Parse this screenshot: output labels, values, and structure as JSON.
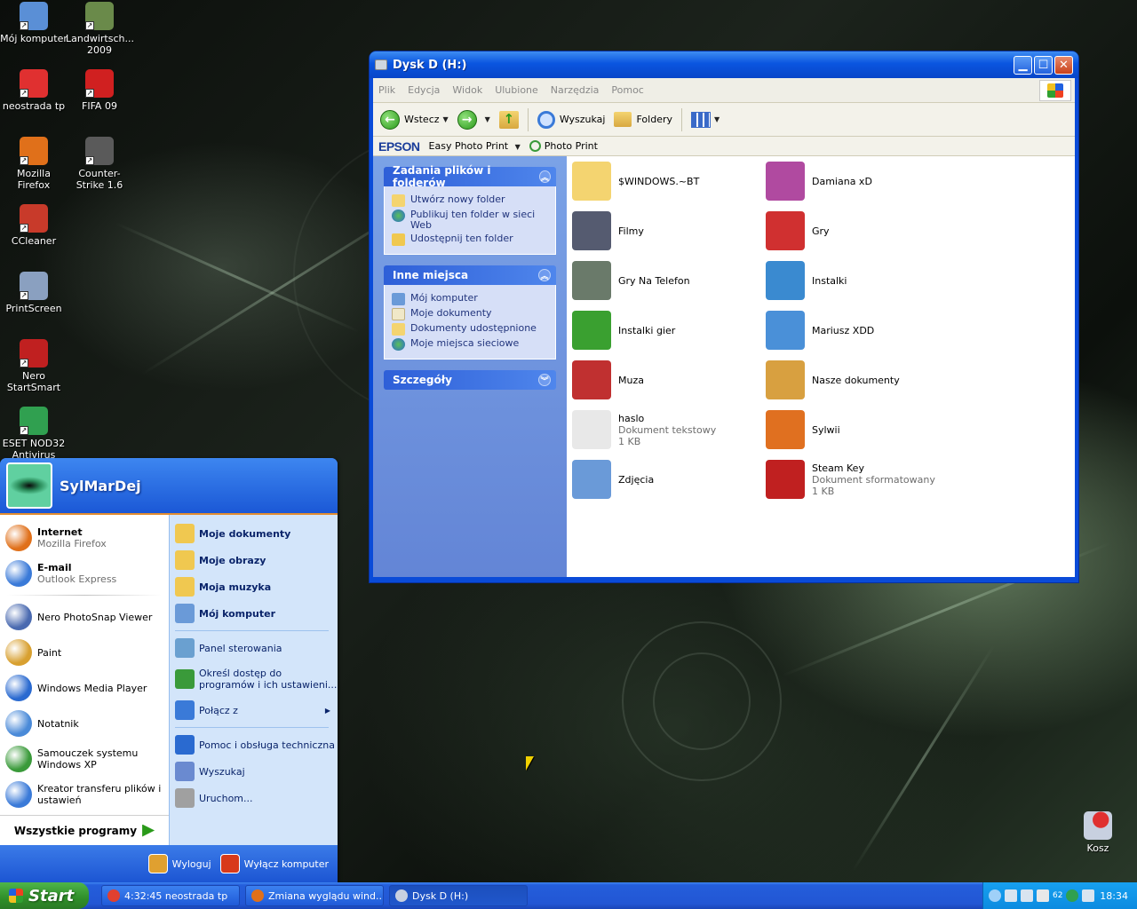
{
  "desktop": {
    "icons": [
      {
        "label": "Mój komputer",
        "icon": "computer-icon",
        "color": "#5a8fd6"
      },
      {
        "label": "Landwirtsch... 2009",
        "icon": "tractor-icon",
        "color": "#6a8a4a"
      },
      {
        "label": "neostrada tp",
        "icon": "tp-logo-icon",
        "color": "#e03030"
      },
      {
        "label": "FIFA 09",
        "icon": "fifa-icon",
        "color": "#d02020"
      },
      {
        "label": "Mozilla Firefox",
        "icon": "firefox-icon",
        "color": "#e0701a"
      },
      {
        "label": "Counter-Strike 1.6",
        "icon": "counter-strike-icon",
        "color": "#5a5a5a"
      },
      {
        "label": "CCleaner",
        "icon": "ccleaner-icon",
        "color": "#c83a2a"
      },
      {
        "label": "PrintScreen",
        "icon": "printscreen-icon",
        "color": "#8aa0c0"
      },
      {
        "label": "Nero StartSmart",
        "icon": "nero-icon",
        "color": "#c02020"
      },
      {
        "label": "ESET NOD32 Antivirus",
        "icon": "eset-icon",
        "color": "#30a050"
      }
    ],
    "recycle_bin": "Kosz"
  },
  "window": {
    "title": "Dysk D (H:)",
    "menu": [
      "Plik",
      "Edycja",
      "Widok",
      "Ulubione",
      "Narzędzia",
      "Pomoc"
    ],
    "toolbar": {
      "back": "Wstecz",
      "search": "Wyszukaj",
      "folders": "Foldery"
    },
    "epson": {
      "brand": "EPSON",
      "easy_photo_print": "Easy Photo Print",
      "photo_print": "Photo Print"
    },
    "taskpane": {
      "file_tasks": {
        "title": "Zadania plików i folderów",
        "items": [
          "Utwórz nowy folder",
          "Publikuj ten folder w sieci Web",
          "Udostępnij ten folder"
        ]
      },
      "other_places": {
        "title": "Inne miejsca",
        "items": [
          "Mój komputer",
          "Moje dokumenty",
          "Dokumenty udostępnione",
          "Moje miejsca sieciowe"
        ]
      },
      "details": {
        "title": "Szczegóły"
      }
    },
    "files": [
      {
        "name": "$WINDOWS.~BT",
        "sub1": "",
        "sub2": "",
        "icon": "folder-icon",
        "color": "#f4d470"
      },
      {
        "name": "Damiana xD",
        "sub1": "",
        "sub2": "",
        "icon": "winrar-icon",
        "color": "#b04aa0"
      },
      {
        "name": "Filmy",
        "sub1": "",
        "sub2": "",
        "icon": "film-folder-icon",
        "color": "#555b70"
      },
      {
        "name": "Gry",
        "sub1": "",
        "sub2": "",
        "icon": "car-folder-icon",
        "color": "#d03030"
      },
      {
        "name": "Gry Na Telefon",
        "sub1": "",
        "sub2": "",
        "icon": "phone-icon",
        "color": "#6a7a6a"
      },
      {
        "name": "Instalki",
        "sub1": "",
        "sub2": "",
        "icon": "installer-icon",
        "color": "#3a8ad0"
      },
      {
        "name": "Instalki gier",
        "sub1": "",
        "sub2": "",
        "icon": "download-arrow-icon",
        "color": "#3aa030"
      },
      {
        "name": "Mariusz XDD",
        "sub1": "",
        "sub2": "",
        "icon": "paint-palette-icon",
        "color": "#4a90d8"
      },
      {
        "name": "Muza",
        "sub1": "",
        "sub2": "",
        "icon": "headphones-icon",
        "color": "#c03030"
      },
      {
        "name": "Nasze dokumenty",
        "sub1": "",
        "sub2": "",
        "icon": "user-documents-icon",
        "color": "#d8a040"
      },
      {
        "name": "haslo",
        "sub1": "Dokument tekstowy",
        "sub2": "1 KB",
        "icon": "text-file-icon",
        "color": "#e8e8e8"
      },
      {
        "name": "Sylwii",
        "sub1": "",
        "sub2": "",
        "icon": "msn-butterfly-icon",
        "color": "#e07020"
      },
      {
        "name": "Zdjęcia",
        "sub1": "",
        "sub2": "",
        "icon": "pictures-folder-icon",
        "color": "#6a9ad8"
      },
      {
        "name": "Steam Key",
        "sub1": "Dokument sformatowany",
        "sub2": "1 KB",
        "icon": "rich-text-file-icon",
        "color": "#c02020"
      }
    ]
  },
  "startmenu": {
    "user": "SylMarDej",
    "pinned": [
      {
        "title": "Internet",
        "subtitle": "Mozilla Firefox",
        "icon": "firefox-icon",
        "color": "#e0701a"
      },
      {
        "title": "E-mail",
        "subtitle": "Outlook Express",
        "icon": "outlook-express-icon",
        "color": "#3a7ad8"
      }
    ],
    "recent": [
      {
        "title": "Nero PhotoSnap Viewer",
        "icon": "nero-photosnap-icon",
        "color": "#4a6ab0"
      },
      {
        "title": "Paint",
        "icon": "paint-icon",
        "color": "#d8a030"
      },
      {
        "title": "Windows Media Player",
        "icon": "media-player-icon",
        "color": "#2a6ad0"
      },
      {
        "title": "Notatnik",
        "icon": "notepad-icon",
        "color": "#4a8ad8"
      },
      {
        "title": "Samouczek systemu Windows XP",
        "icon": "tour-icon",
        "color": "#3a9a3a"
      },
      {
        "title": "Kreator transferu plików i ustawień",
        "icon": "transfer-wizard-icon",
        "color": "#3a7ad8"
      }
    ],
    "all_programs": "Wszystkie programy",
    "right": {
      "group1": [
        {
          "title": "Moje dokumenty",
          "icon": "my-documents-icon",
          "color": "#f0c850"
        },
        {
          "title": "Moje obrazy",
          "icon": "my-pictures-icon",
          "color": "#f0c850"
        },
        {
          "title": "Moja muzyka",
          "icon": "my-music-icon",
          "color": "#f0c850"
        },
        {
          "title": "Mój komputer",
          "icon": "computer-icon",
          "color": "#6a9ad8"
        }
      ],
      "group2": [
        {
          "title": "Panel sterowania",
          "icon": "control-panel-icon",
          "color": "#6aa0d0"
        },
        {
          "title": "Określ dostęp do programów i ich ustawieni...",
          "icon": "program-access-icon",
          "color": "#3a9a3a"
        },
        {
          "title": "Połącz z",
          "icon": "connect-icon",
          "color": "#3a7ad8"
        }
      ],
      "group3": [
        {
          "title": "Pomoc i obsługa techniczna",
          "icon": "help-icon",
          "color": "#2a6ad0"
        },
        {
          "title": "Wyszukaj",
          "icon": "search-icon",
          "color": "#6a8ad0"
        },
        {
          "title": "Uruchom...",
          "icon": "run-icon",
          "color": "#a0a0a0"
        }
      ]
    },
    "logoff": "Wyloguj",
    "shutdown": "Wyłącz komputer"
  },
  "taskbar": {
    "start": "Start",
    "tasks": [
      {
        "label": "4:32:45 neostrada tp",
        "icon": "tp-logo-icon",
        "color": "#e04030"
      },
      {
        "label": "Zmiana wyglądu wind...",
        "icon": "firefox-icon",
        "color": "#e0701a"
      },
      {
        "label": "Dysk D (H:)",
        "icon": "drive-icon",
        "color": "#c8d0e0"
      }
    ],
    "tray_badge": "62",
    "clock": "18:34"
  }
}
